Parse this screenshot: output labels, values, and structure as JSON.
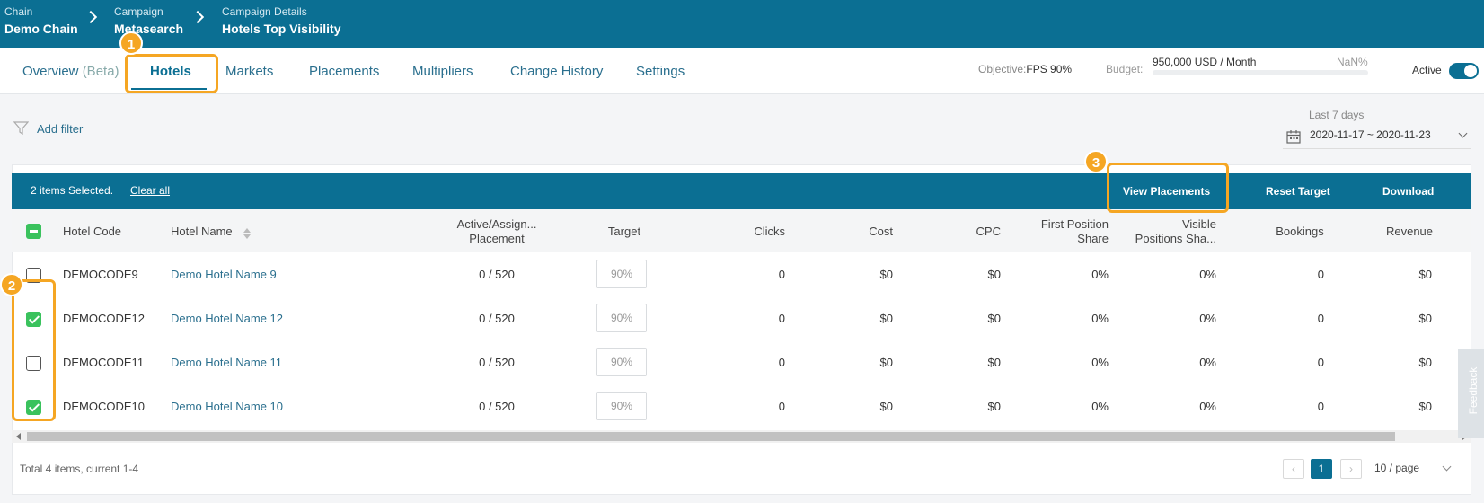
{
  "breadcrumb": [
    {
      "label": "Chain",
      "value": "Demo Chain"
    },
    {
      "label": "Campaign",
      "value": "Metasearch"
    },
    {
      "label": "Campaign Details",
      "value": "Hotels Top Visibility"
    }
  ],
  "tabs": [
    {
      "label": "Overview",
      "suffix": "(Beta)"
    },
    {
      "label": "Hotels",
      "active": true
    },
    {
      "label": "Markets"
    },
    {
      "label": "Placements"
    },
    {
      "label": "Multipliers"
    },
    {
      "label": "Change History"
    },
    {
      "label": "Settings"
    }
  ],
  "status": {
    "objective_label": "Objective:",
    "objective_value": "FPS 90%",
    "budget_label": "Budget:",
    "budget_value": "950,000 USD / Month",
    "budget_percent": "NaN%",
    "active_label": "Active",
    "active_on": true
  },
  "filter": {
    "add_filter_label": "Add filter"
  },
  "date_range": {
    "label": "Last 7 days",
    "value": "2020-11-17 ~ 2020-11-23"
  },
  "selection": {
    "text": "2 items Selected.",
    "clear_label": "Clear all",
    "actions": [
      "View Placements",
      "Reset Target",
      "Download"
    ]
  },
  "table": {
    "columns": [
      "Hotel Code",
      "Hotel Name",
      "Active/Assign... Placement",
      "Target",
      "Clicks",
      "Cost",
      "CPC",
      "First Position Share",
      "Visible Positions Sha...",
      "Bookings",
      "Revenue"
    ],
    "col_lines": {
      "placement": [
        "Active/Assign...",
        "Placement"
      ],
      "fps": [
        "First Position",
        "Share"
      ],
      "vps": [
        "Visible",
        "Positions Sha..."
      ]
    },
    "rows": [
      {
        "checked": false,
        "code": "DEMOCODE9",
        "name": "Demo Hotel Name 9",
        "placement": "0 / 520",
        "target": "90%",
        "clicks": "0",
        "cost": "$0",
        "cpc": "$0",
        "fps": "0%",
        "vps": "0%",
        "bookings": "0",
        "revenue": "$0"
      },
      {
        "checked": true,
        "code": "DEMOCODE12",
        "name": "Demo Hotel Name 12",
        "placement": "0 / 520",
        "target": "90%",
        "clicks": "0",
        "cost": "$0",
        "cpc": "$0",
        "fps": "0%",
        "vps": "0%",
        "bookings": "0",
        "revenue": "$0"
      },
      {
        "checked": false,
        "code": "DEMOCODE11",
        "name": "Demo Hotel Name 11",
        "placement": "0 / 520",
        "target": "90%",
        "clicks": "0",
        "cost": "$0",
        "cpc": "$0",
        "fps": "0%",
        "vps": "0%",
        "bookings": "0",
        "revenue": "$0"
      },
      {
        "checked": true,
        "code": "DEMOCODE10",
        "name": "Demo Hotel Name 10",
        "placement": "0 / 520",
        "target": "90%",
        "clicks": "0",
        "cost": "$0",
        "cpc": "$0",
        "fps": "0%",
        "vps": "0%",
        "bookings": "0",
        "revenue": "$0"
      }
    ]
  },
  "pagination": {
    "total_text": "Total 4 items, current 1-4",
    "current_page": "1",
    "page_size": "10 / page"
  },
  "feedback_label": "Feedback",
  "annotations": [
    "1",
    "2",
    "3"
  ],
  "colors": {
    "primary": "#0b6f93",
    "checkbox": "#3ac25d",
    "highlight": "#f5a623"
  }
}
